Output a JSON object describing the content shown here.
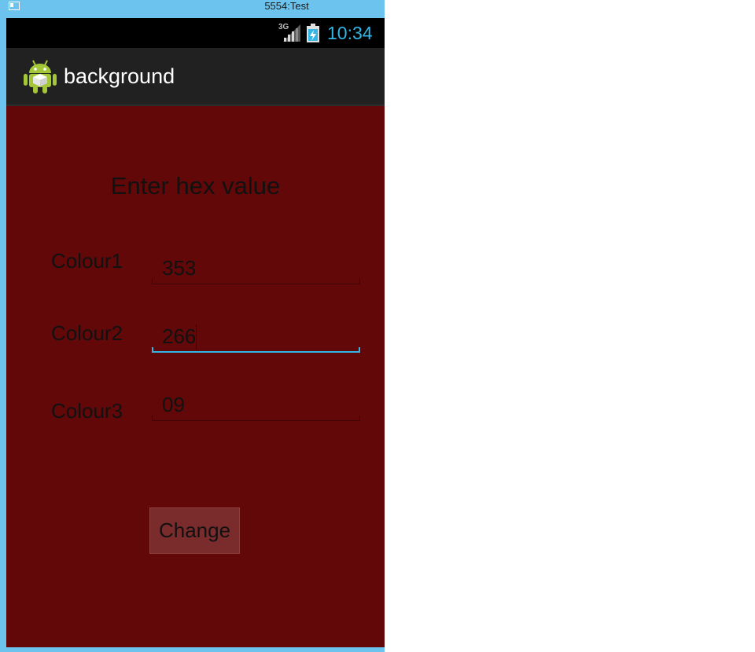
{
  "window": {
    "title": "5554:Test"
  },
  "status_bar": {
    "network_type": "3G",
    "time": "10:34",
    "accent_color": "#33b5e5"
  },
  "action_bar": {
    "app_icon": "android-robot-icon",
    "title": "background"
  },
  "form": {
    "heading": "Enter hex value",
    "fields": [
      {
        "label": "Colour1",
        "value": "353",
        "focused": false
      },
      {
        "label": "Colour2",
        "value": "266",
        "focused": true
      },
      {
        "label": "Colour3",
        "value": "09",
        "focused": false
      }
    ],
    "button_label": "Change"
  },
  "colors": {
    "background": "#620808",
    "focus_underline": "#33b5e5"
  }
}
